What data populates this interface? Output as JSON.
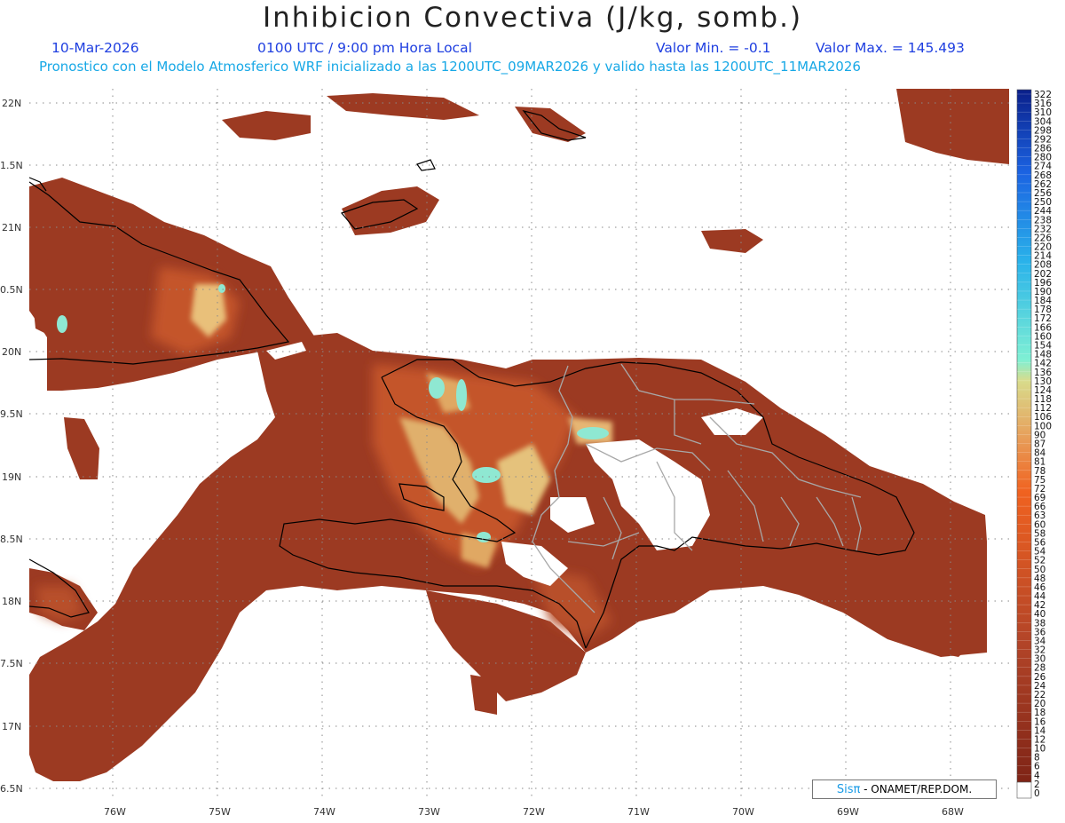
{
  "header": {
    "title": "Inhibicion Convectiva (J/kg, somb.)",
    "date": "10-Mar-2026",
    "time": "0100 UTC / 9:00 pm Hora Local",
    "valmin": "Valor Min. = -0.1",
    "valmax": "Valor Max. = 145.493",
    "forecast": "Pronostico con el Modelo Atmosferico WRF inicializado a las 1200UTC_09MAR2026 y valido hasta las  1200UTC_11MAR2026"
  },
  "map": {
    "lat_labels": [
      "22N",
      "1.5N",
      "21N",
      "0.5N",
      "20N",
      "9.5N",
      "19N",
      "8.5N",
      "18N",
      "7.5N",
      "17N",
      "6.5N"
    ],
    "lon_labels": [
      "76W",
      "75W",
      "74W",
      "73W",
      "72W",
      "71W",
      "70W",
      "69W",
      "68W"
    ],
    "colors": {
      "low": "#9c3a22",
      "mid": "#c4552b",
      "high": "#e9c07a",
      "peak": "#8fe8d2",
      "coast": "#000000",
      "border": "#a8a8a8"
    }
  },
  "colorbar": {
    "labels": [
      "322",
      "316",
      "310",
      "304",
      "298",
      "292",
      "286",
      "280",
      "274",
      "268",
      "262",
      "256",
      "250",
      "244",
      "238",
      "232",
      "226",
      "220",
      "214",
      "208",
      "202",
      "196",
      "190",
      "184",
      "178",
      "172",
      "166",
      "160",
      "154",
      "148",
      "142",
      "136",
      "130",
      "124",
      "118",
      "112",
      "106",
      "100",
      "90",
      "87",
      "84",
      "81",
      "78",
      "75",
      "72",
      "69",
      "66",
      "63",
      "60",
      "58",
      "56",
      "54",
      "52",
      "50",
      "48",
      "46",
      "44",
      "42",
      "40",
      "38",
      "36",
      "34",
      "32",
      "30",
      "28",
      "26",
      "24",
      "22",
      "20",
      "18",
      "16",
      "14",
      "12",
      "10",
      "8",
      "6",
      "4",
      "2",
      "0"
    ]
  },
  "credit": {
    "logo": "Sisπ",
    "text": "- ONAMET/REP.DOM."
  }
}
